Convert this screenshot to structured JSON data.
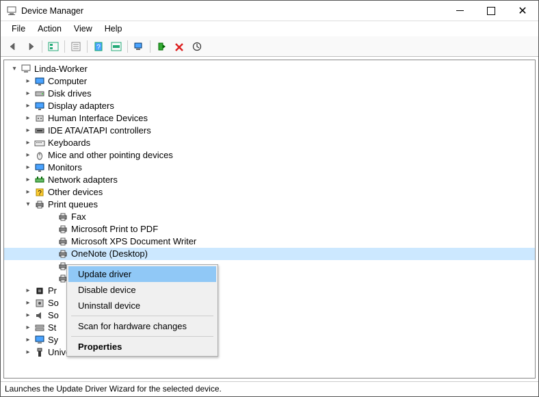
{
  "window": {
    "title": "Device Manager"
  },
  "menu": {
    "items": [
      "File",
      "Action",
      "View",
      "Help"
    ]
  },
  "tree": {
    "root": "Linda-Worker",
    "categories": [
      {
        "label": "Computer",
        "expanded": false,
        "icon": "monitor"
      },
      {
        "label": "Disk drives",
        "expanded": false,
        "icon": "disk"
      },
      {
        "label": "Display adapters",
        "expanded": false,
        "icon": "monitor"
      },
      {
        "label": "Human Interface Devices",
        "expanded": false,
        "icon": "hid"
      },
      {
        "label": "IDE ATA/ATAPI controllers",
        "expanded": false,
        "icon": "ide"
      },
      {
        "label": "Keyboards",
        "expanded": false,
        "icon": "keyboard"
      },
      {
        "label": "Mice and other pointing devices",
        "expanded": false,
        "icon": "mouse"
      },
      {
        "label": "Monitors",
        "expanded": false,
        "icon": "monitor"
      },
      {
        "label": "Network adapters",
        "expanded": false,
        "icon": "network"
      },
      {
        "label": "Other devices",
        "expanded": false,
        "icon": "other"
      },
      {
        "label": "Print queues",
        "expanded": true,
        "icon": "printer",
        "children": [
          {
            "label": "Fax",
            "icon": "printer"
          },
          {
            "label": "Microsoft Print to PDF",
            "icon": "printer"
          },
          {
            "label": "Microsoft XPS Document Writer",
            "icon": "printer"
          },
          {
            "label": "OneNote (Desktop)",
            "icon": "printer",
            "selected": true
          },
          {
            "label": "",
            "icon": "printer",
            "obscured": true
          },
          {
            "label": "",
            "icon": "printer",
            "obscured": true
          }
        ]
      },
      {
        "label": "Pr",
        "expanded": false,
        "icon": "cpu",
        "obscured": true
      },
      {
        "label": "So",
        "expanded": false,
        "icon": "software",
        "obscured": true
      },
      {
        "label": "So",
        "expanded": false,
        "icon": "sound",
        "obscured": true
      },
      {
        "label": "St",
        "expanded": false,
        "icon": "storage",
        "obscured": true
      },
      {
        "label": "Sy",
        "expanded": false,
        "icon": "system",
        "obscured": true
      },
      {
        "label": "Universal Serial Bus controllers",
        "expanded": false,
        "icon": "usb",
        "obscured_partial": true
      }
    ]
  },
  "context_menu": {
    "items": [
      {
        "label": "Update driver",
        "highlighted": true
      },
      {
        "label": "Disable device"
      },
      {
        "label": "Uninstall device"
      },
      {
        "sep": true
      },
      {
        "label": "Scan for hardware changes"
      },
      {
        "sep": true
      },
      {
        "label": "Properties",
        "bold": true
      }
    ]
  },
  "statusbar": {
    "text": "Launches the Update Driver Wizard for the selected device."
  },
  "icons": {
    "app": "pc",
    "back": "←",
    "fwd": "→"
  }
}
